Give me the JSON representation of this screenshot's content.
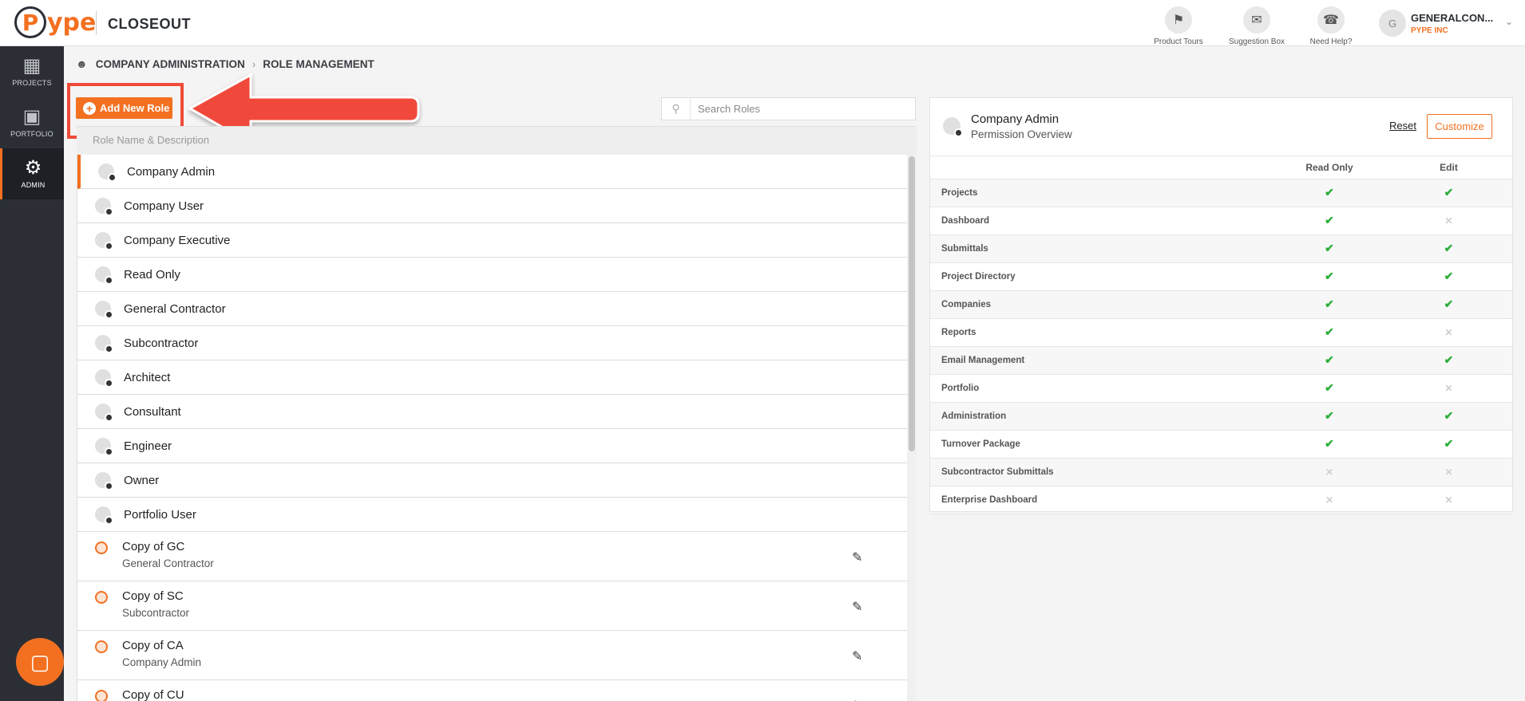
{
  "header": {
    "logo_circle": "P",
    "logo_text": "ype",
    "app_title": "CLOSEOUT",
    "tools": [
      {
        "label": "Product Tours",
        "icon": "signpost-icon"
      },
      {
        "label": "Suggestion Box",
        "icon": "suggestion-box-icon"
      },
      {
        "label": "Need Help?",
        "icon": "phone-help-icon"
      }
    ],
    "user": {
      "initial": "G",
      "name": "GENERALCON...",
      "company": "PYPE INC"
    }
  },
  "sidebar": {
    "items": [
      {
        "label": "PROJECTS",
        "icon": "building-icon"
      },
      {
        "label": "PORTFOLIO",
        "icon": "briefcase-icon"
      },
      {
        "label": "ADMIN",
        "icon": "gear-icon"
      }
    ]
  },
  "breadcrumb": {
    "level1": "COMPANY ADMINISTRATION",
    "level2": "ROLE MANAGEMENT"
  },
  "toolbar": {
    "add_label": "Add New Role",
    "search_placeholder": "Search Roles"
  },
  "list": {
    "header": "Role Name & Description",
    "system_roles": [
      "Company Admin",
      "Company User",
      "Company Executive",
      "Read Only",
      "General Contractor",
      "Subcontractor",
      "Architect",
      "Consultant",
      "Engineer",
      "Owner",
      "Portfolio User"
    ],
    "custom_roles": [
      {
        "name": "Copy of GC",
        "description": "General Contractor"
      },
      {
        "name": "Copy of SC",
        "description": "Subcontractor"
      },
      {
        "name": "Copy of CA",
        "description": "Company Admin"
      },
      {
        "name": "Copy of CU",
        "description": ""
      }
    ]
  },
  "permissions": {
    "role_title": "Company Admin",
    "subtitle": "Permission Overview",
    "reset_label": "Reset",
    "customize_label": "Customize",
    "col_read": "Read Only",
    "col_edit": "Edit",
    "rows": [
      {
        "feature": "Projects",
        "read": true,
        "edit": true
      },
      {
        "feature": "Dashboard",
        "read": true,
        "edit": false
      },
      {
        "feature": "Submittals",
        "read": true,
        "edit": true
      },
      {
        "feature": "Project Directory",
        "read": true,
        "edit": true
      },
      {
        "feature": "Companies",
        "read": true,
        "edit": true
      },
      {
        "feature": "Reports",
        "read": true,
        "edit": false
      },
      {
        "feature": "Email Management",
        "read": true,
        "edit": true
      },
      {
        "feature": "Portfolio",
        "read": true,
        "edit": false
      },
      {
        "feature": "Administration",
        "read": true,
        "edit": true
      },
      {
        "feature": "Turnover Package",
        "read": true,
        "edit": true
      },
      {
        "feature": "Subcontractor Submittals",
        "read": false,
        "edit": false
      },
      {
        "feature": "Enterprise Dashboard",
        "read": false,
        "edit": false
      }
    ]
  },
  "colors": {
    "accent": "#f37021",
    "sidebar": "#2b2f35",
    "highlight": "#f04a3a",
    "check": "#2eae3a"
  }
}
